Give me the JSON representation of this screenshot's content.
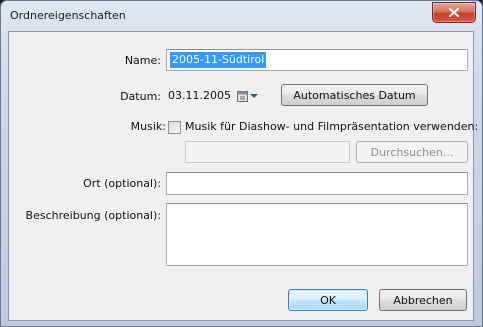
{
  "window": {
    "title": "Ordnereigenschaften"
  },
  "form": {
    "name_label": "Name:",
    "name_value": "2005-11-Südtirol",
    "date_label": "Datum:",
    "date_value": "03.11.2005",
    "auto_date_button": "Automatisches Datum",
    "music_label": "Musik:",
    "music_checkbox_label": "Musik für Diashow- und Filmpräsentation verwenden:",
    "music_checked": false,
    "music_path": "",
    "browse_button": "Durchsuchen...",
    "location_label": "Ort (optional):",
    "location_value": "",
    "description_label": "Beschreibung (optional):",
    "description_value": ""
  },
  "buttons": {
    "ok": "OK",
    "cancel": "Abbrechen"
  },
  "icons": {
    "close": "close-icon",
    "calendar": "calendar-icon",
    "dropdown": "chevron-down-icon"
  }
}
